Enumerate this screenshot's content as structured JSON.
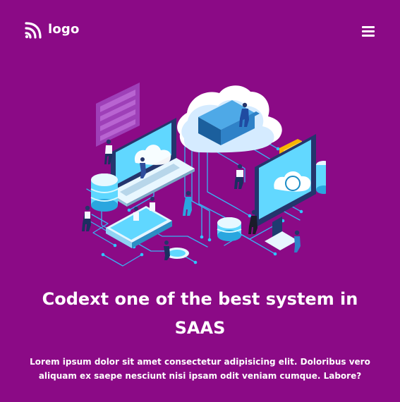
{
  "header": {
    "logo_text": "logo",
    "logo_icon": "rss-icon",
    "menu_icon": "hamburger-menu-icon"
  },
  "hero": {
    "illustration": "isometric-cloud-network-illustration",
    "title": "Codext one of the best system in SAAS",
    "description": "Lorem ipsum dolor sit amet consectetur adipisicing elit. Doloribus vero aliquam ex saepe nesciunt nisi ipsam odit veniam cumque. Labore?"
  },
  "colors": {
    "background": "#8b0a86",
    "text": "#ffffff",
    "illustration_primary": "#2fc7ff",
    "illustration_secondary": "#f7b500"
  }
}
